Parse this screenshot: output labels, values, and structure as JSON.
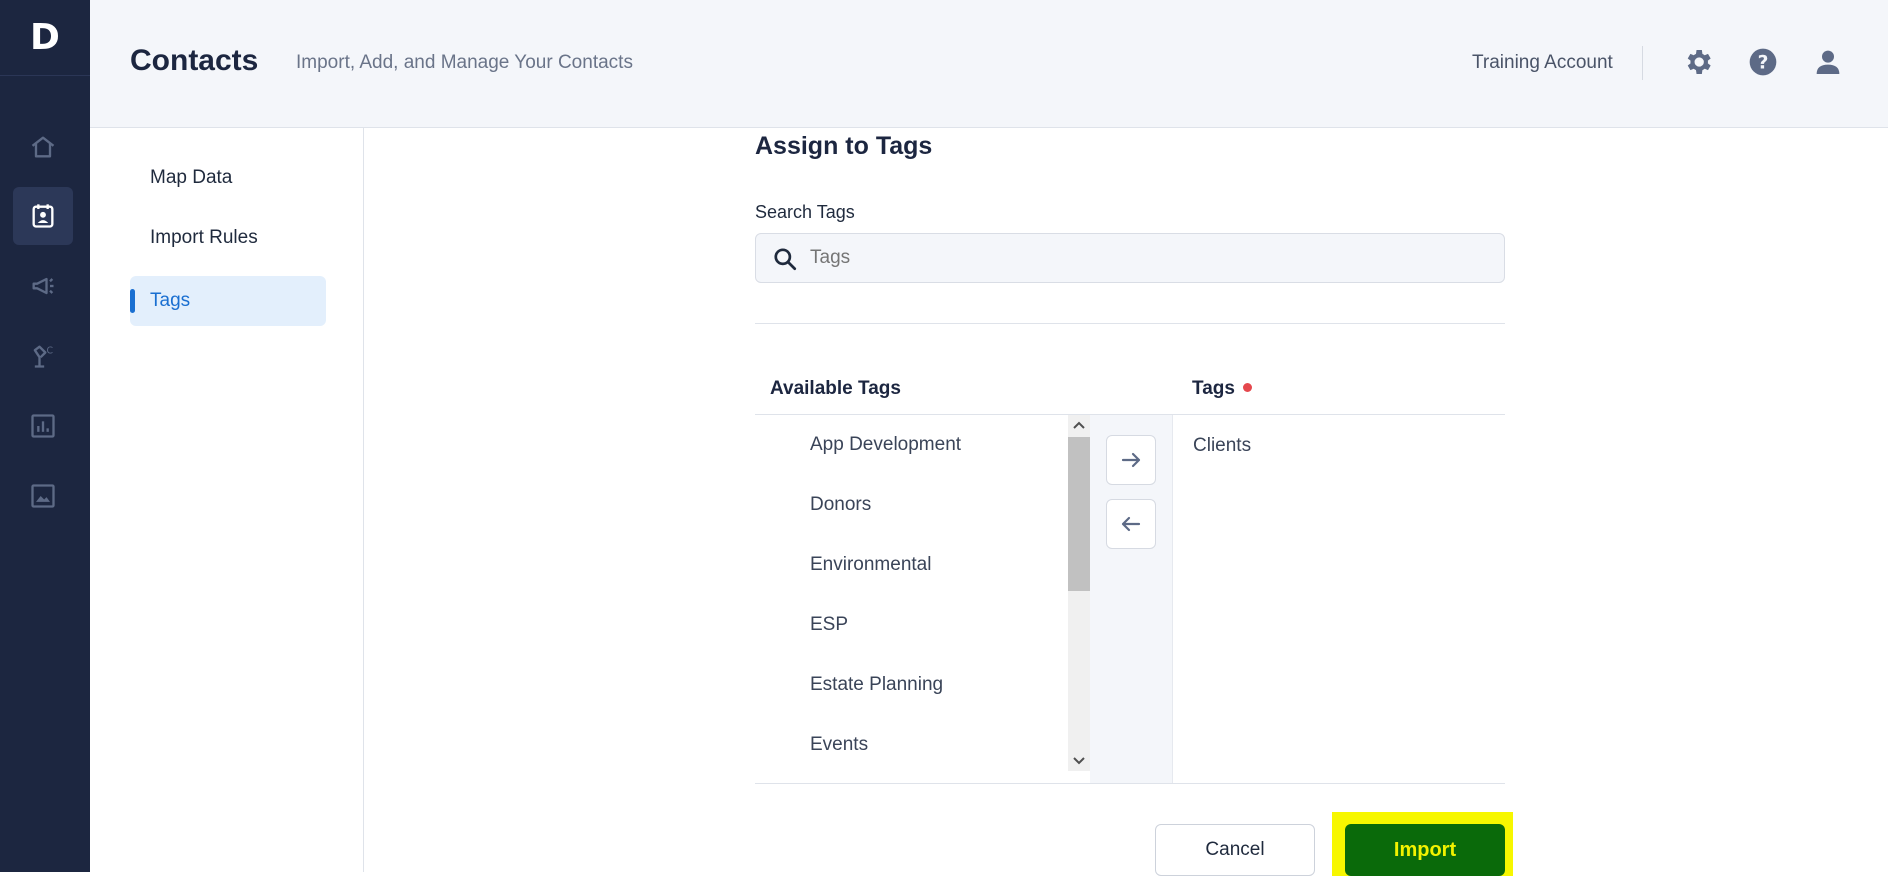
{
  "app": {
    "logo_letter": "D"
  },
  "rail": {
    "items": [
      {
        "name": "home-icon",
        "active": false
      },
      {
        "name": "contacts-icon",
        "active": true
      },
      {
        "name": "megaphone-icon",
        "active": false
      },
      {
        "name": "automation-icon",
        "active": false
      },
      {
        "name": "reports-icon",
        "active": false
      },
      {
        "name": "image-icon",
        "active": false
      }
    ]
  },
  "header": {
    "title": "Contacts",
    "subtitle": "Import, Add, and Manage Your Contacts",
    "account": "Training Account",
    "icons": [
      "gear-icon",
      "help-icon",
      "user-icon"
    ]
  },
  "subnav": {
    "items": [
      {
        "label": "Map Data",
        "active": false
      },
      {
        "label": "Import Rules",
        "active": false
      },
      {
        "label": "Tags",
        "active": true
      }
    ]
  },
  "main": {
    "section_title": "Assign to Tags",
    "search": {
      "label": "Search Tags",
      "placeholder": "Tags",
      "value": ""
    },
    "available": {
      "header": "Available Tags",
      "items": [
        "App Development",
        "Donors",
        "Environmental",
        "ESP",
        "Estate Planning",
        "Events"
      ]
    },
    "selected": {
      "header": "Tags",
      "required": true,
      "items": [
        "Clients"
      ]
    },
    "buttons": {
      "cancel": "Cancel",
      "import": "Import"
    },
    "colors": {
      "accent": "#1a6fd1",
      "import_bg": "#0a6a0a",
      "import_text": "#f2f200",
      "highlight": "#f7f700",
      "required_dot": "#e5484d"
    }
  }
}
